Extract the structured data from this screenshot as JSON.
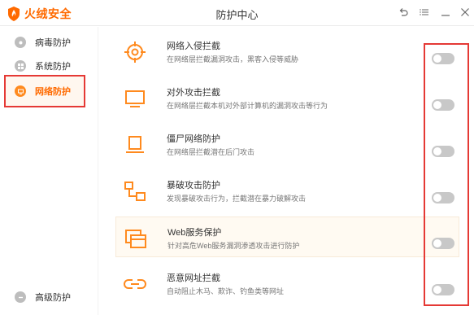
{
  "app": {
    "logo_text": "火绒安全",
    "title": "防护中心",
    "controls": {
      "back_icon": "back-icon",
      "menu_icon": "menu-icon",
      "minimize_icon": "minimize-icon",
      "close_icon": "close-icon"
    },
    "accent": "#ff6a00",
    "highlight_red": "#e53935"
  },
  "sidebar": {
    "items": [
      {
        "label": "病毒防护",
        "icon": "virus-protect-icon",
        "active": false
      },
      {
        "label": "系统防护",
        "icon": "system-protect-icon",
        "active": false
      },
      {
        "label": "网络防护",
        "icon": "network-protect-icon",
        "active": true
      }
    ],
    "bottom_item": {
      "label": "高级防护",
      "icon": "advanced-protect-icon"
    }
  },
  "features": [
    {
      "title": "网络入侵拦截",
      "desc": "在网络层拦截漏洞攻击，黑客入侵等威胁",
      "icon": "crosshair-icon",
      "enabled": false
    },
    {
      "title": "对外攻击拦截",
      "desc": "在网络层拦截本机对外部计算机的漏洞攻击等行为",
      "icon": "monitor-icon",
      "enabled": false
    },
    {
      "title": "僵尸网络防护",
      "desc": "在网络层拦截潜在后门攻击",
      "icon": "laptop-icon",
      "enabled": false
    },
    {
      "title": "暴破攻击防护",
      "desc": "发现暴破攻击行为，拦截潜在暴力破解攻击",
      "icon": "network-nodes-icon",
      "enabled": false
    },
    {
      "title": "Web服务保护",
      "desc": "针对高危Web服务漏洞渗透攻击进行防护",
      "icon": "web-window-icon",
      "enabled": false
    },
    {
      "title": "恶意网址拦截",
      "desc": "自动阻止木马、欺诈、钓鱼类等网址",
      "icon": "link-icon",
      "enabled": false
    }
  ]
}
